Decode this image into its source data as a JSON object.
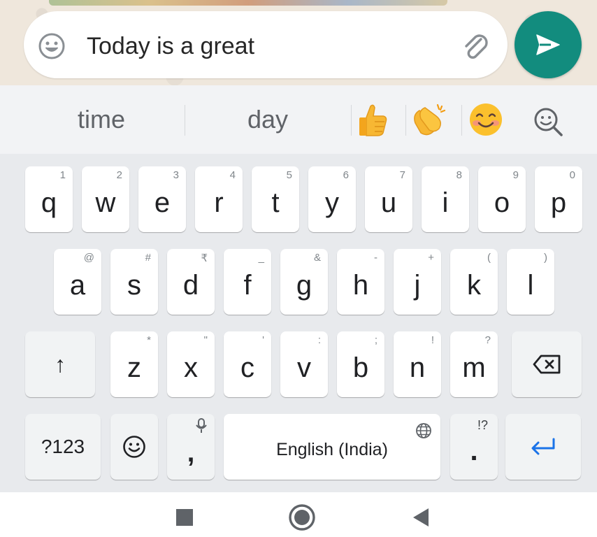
{
  "compose": {
    "message_value": "Today is a great",
    "emoji_icon": "smiley-face-icon",
    "attach_icon": "paperclip-icon",
    "send_icon": "send-arrow-icon"
  },
  "suggestions": {
    "words": [
      "time",
      "day"
    ],
    "emojis": [
      "👍",
      "👏",
      "😊"
    ],
    "emoji_names": [
      "thumbs-up-emoji",
      "clapping-hands-emoji",
      "smiling-face-emoji"
    ],
    "search_icon": "emoji-search-icon"
  },
  "keyboard": {
    "row1": [
      {
        "key": "q",
        "hint": "1"
      },
      {
        "key": "w",
        "hint": "2"
      },
      {
        "key": "e",
        "hint": "3"
      },
      {
        "key": "r",
        "hint": "4"
      },
      {
        "key": "t",
        "hint": "5"
      },
      {
        "key": "y",
        "hint": "6"
      },
      {
        "key": "u",
        "hint": "7"
      },
      {
        "key": "i",
        "hint": "8"
      },
      {
        "key": "o",
        "hint": "9"
      },
      {
        "key": "p",
        "hint": "0"
      }
    ],
    "row2": [
      {
        "key": "a",
        "hint": "@"
      },
      {
        "key": "s",
        "hint": "#"
      },
      {
        "key": "d",
        "hint": "₹"
      },
      {
        "key": "f",
        "hint": "_"
      },
      {
        "key": "g",
        "hint": "&"
      },
      {
        "key": "h",
        "hint": "-"
      },
      {
        "key": "j",
        "hint": "+"
      },
      {
        "key": "k",
        "hint": "("
      },
      {
        "key": "l",
        "hint": ")"
      }
    ],
    "row3": [
      {
        "key": "z",
        "hint": "*"
      },
      {
        "key": "x",
        "hint": "\""
      },
      {
        "key": "c",
        "hint": "'"
      },
      {
        "key": "v",
        "hint": ":"
      },
      {
        "key": "b",
        "hint": ";"
      },
      {
        "key": "n",
        "hint": "!"
      },
      {
        "key": "m",
        "hint": "?"
      }
    ],
    "shift_label": "↑",
    "symbols_label": "?123",
    "comma_label": ",",
    "space_label": "English (India)",
    "period_label": ".",
    "period_hint": "!?",
    "enter_label": "↵"
  },
  "colors": {
    "send_button": "#128c7e",
    "enter_accent": "#1a73e8",
    "key_background": "#ffffff",
    "keyboard_background": "#e8eaed"
  }
}
